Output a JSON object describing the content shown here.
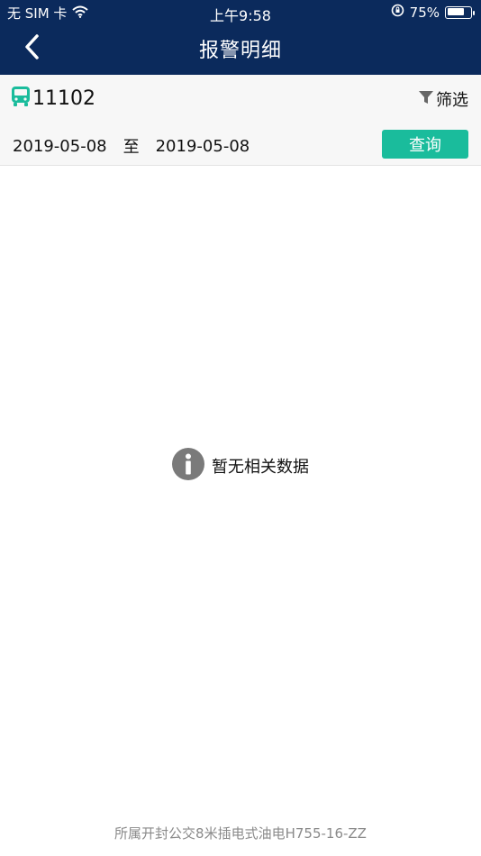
{
  "status_bar": {
    "carrier": "无 SIM 卡",
    "time": "上午9:58",
    "battery_text": "75%",
    "battery_level": 0.75,
    "icons": [
      "wifi-icon",
      "rotation-lock-icon",
      "battery-icon"
    ]
  },
  "nav": {
    "title": "报警明细",
    "back_icon": "chevron-left-icon"
  },
  "filter_panel": {
    "vehicle_icon": "bus-icon",
    "vehicle_id": "11102",
    "filter_icon": "funnel-icon",
    "filter_label": "筛选",
    "start_date": "2019-05-08",
    "range_separator": "至",
    "end_date": "2019-05-08",
    "query_label": "查询"
  },
  "empty_state": {
    "icon": "info-icon",
    "text": "暂无相关数据"
  },
  "footer": {
    "text": "所属开封公交8米插电式油电H755-16-ZZ"
  },
  "colors": {
    "navbar": "#0b2a5c",
    "accent": "#1abc9c",
    "bus_icon": "#1abc9c",
    "info_icon": "#7a7a7a"
  }
}
